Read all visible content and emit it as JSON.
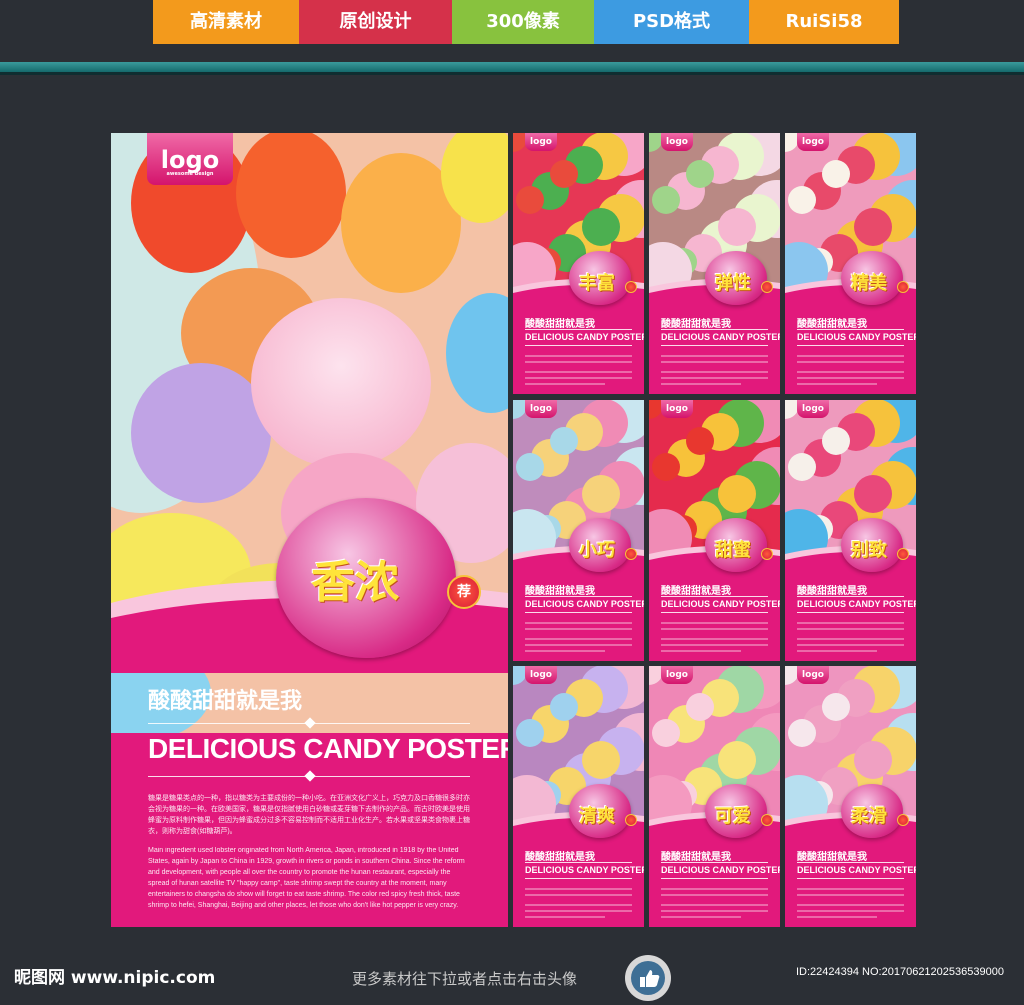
{
  "badges": [
    "高清素材",
    "原创设计",
    "300像素",
    "PSD格式",
    "RuiSi58"
  ],
  "main": {
    "logo": "logo",
    "logo_sub": "awesome design",
    "bubble": "香浓",
    "rosette": "荐",
    "cn_title": "酸酸甜甜就是我",
    "en_title": "DELICIOUS CANDY POSTERS",
    "para_cn": "糖果是糖果类点的一种，指以糖类为主要成份的一种小吃。在亚洲文化广义上，巧克力及口香糖很多时亦会视为糖果的一种。在欧美国家，糖果是仅指腻使用白砂糖或麦芽糖下去制作的产品。而古时欧美是使用蜂蜜为原料制作糖果，但因为蜂蜜成分过多不容易控制而不适用工业化生产。若水果或坚果类食物裹上糖衣，则称为甜食(如糖葫芦)。",
    "para_en": "Main ingredient used lobster originated from North America, Japan, introduced in 1918 by the United States, again by Japan to China in 1929, growth in rivers or ponds in southern China. Since the reform and development, with people all over the country to promote the hunan restaurant, especially the spread of hunan satellite TV \"happy camp\", taste shrimp swept the country at the moment, many entertainers to changsha do show will forget to eat taste shrimp. The color red spicy fresh thick, taste shrimp to hefei, Shanghai, Beijing and other places, let those who don't like hot pepper is very crazy."
  },
  "small_cn": "酸酸甜甜就是我",
  "small_en": "DELICIOUS CANDY POSTERS",
  "small_logo": "logo",
  "thumb_labels": [
    "丰富",
    "弹性",
    "精美",
    "小巧",
    "甜蜜",
    "别致",
    "清爽",
    "可爱",
    "柔滑"
  ],
  "footer": {
    "site": "昵图网 www.nipic.com",
    "more": "更多素材往下拉或者点击右击头像",
    "id": "ID:22424394 NO:20170621202536539000"
  },
  "colors": {
    "poster_pink": "#e2197c",
    "background": "#2b2f35"
  }
}
